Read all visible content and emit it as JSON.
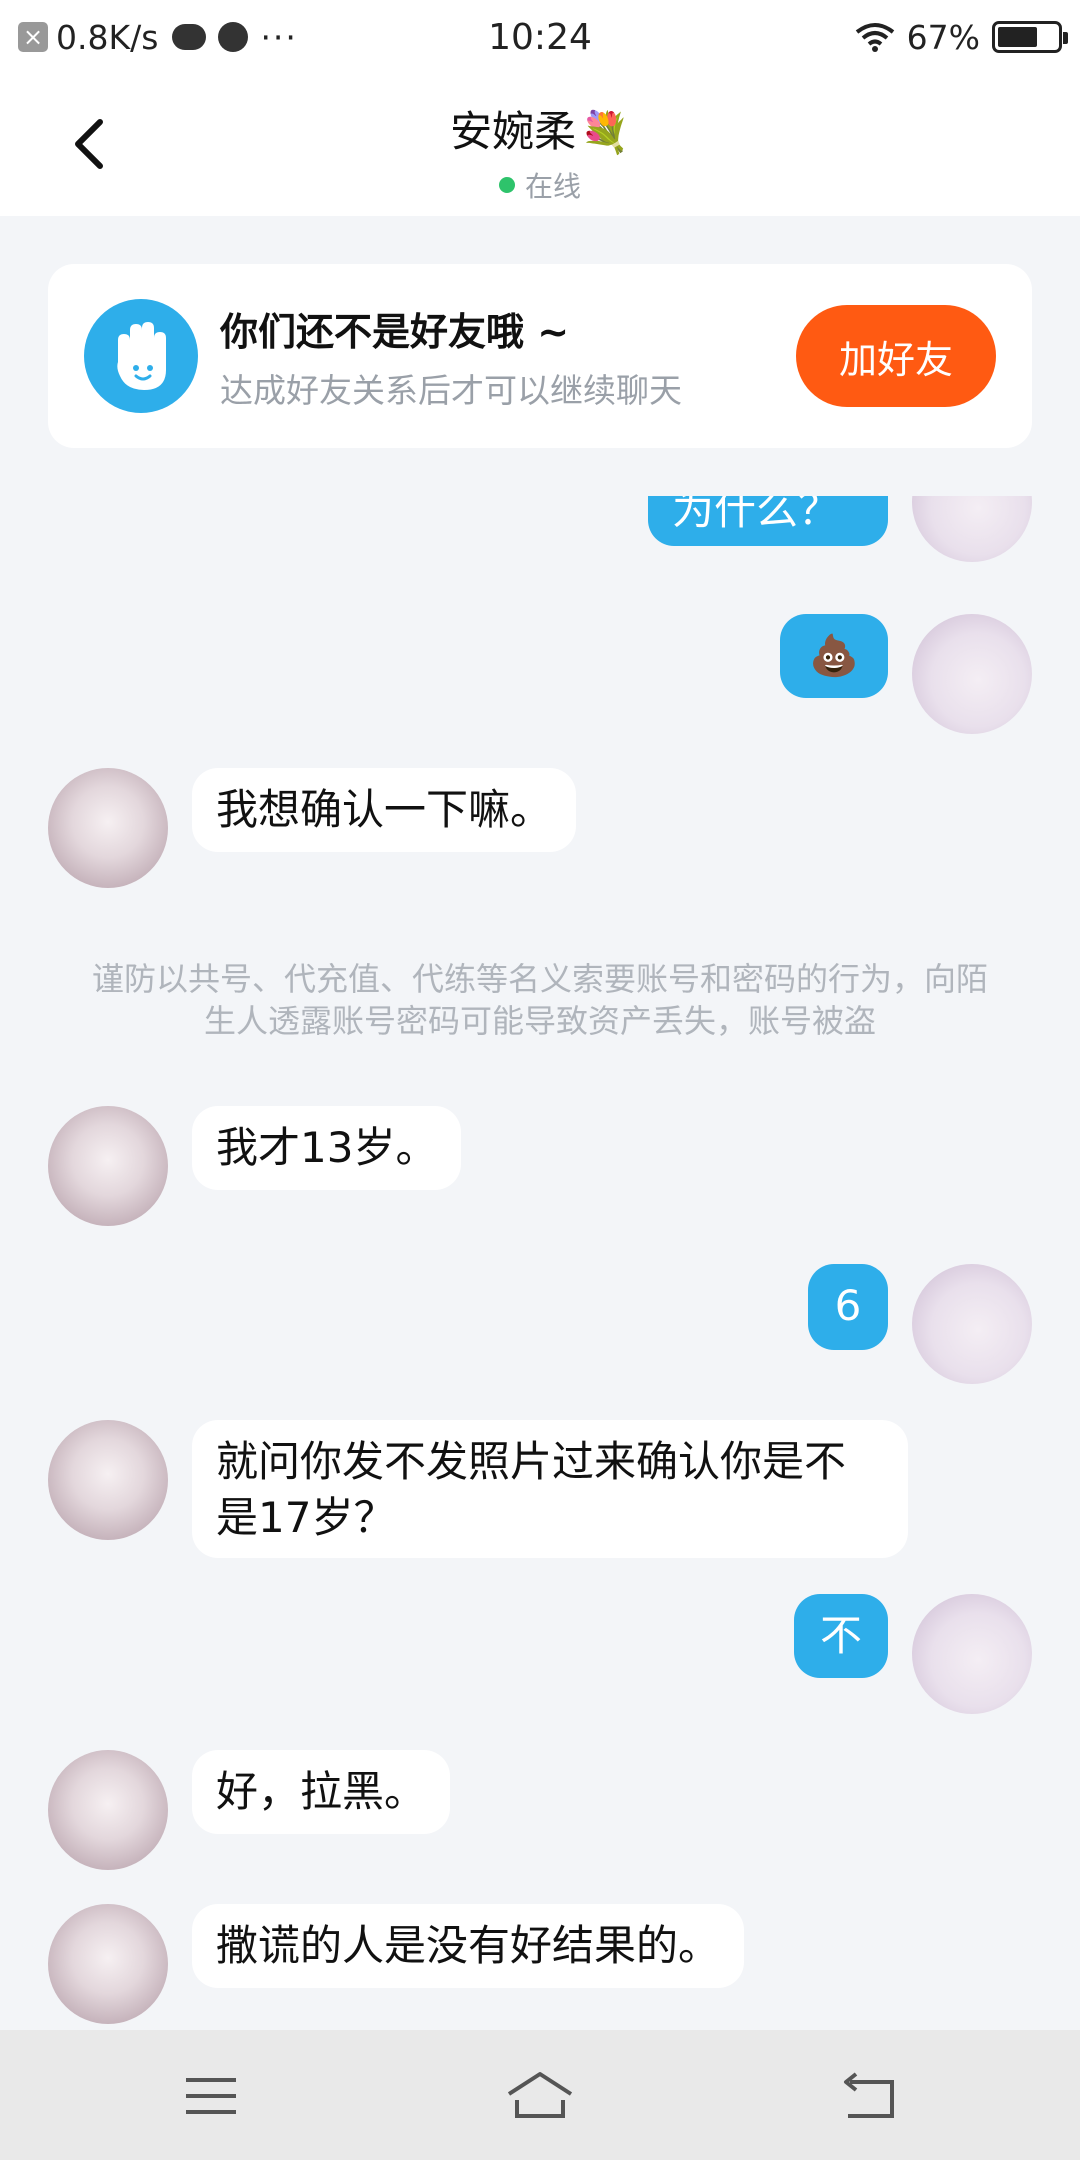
{
  "status_bar": {
    "speed": "0.8K/s",
    "dots": "···",
    "time": "10:24",
    "battery": "67%",
    "battery_level": 0.67
  },
  "header": {
    "title": "安婉柔",
    "title_emoji": "💐",
    "status": "在线"
  },
  "friend_card": {
    "title": "你们还不是好友哦 ~",
    "subtitle": "达成好友关系后才可以继续聊天",
    "button": "加好友"
  },
  "messages": [
    {
      "side": "right",
      "text": "为什么？"
    },
    {
      "side": "right",
      "text": "💩"
    },
    {
      "side": "left",
      "text": "我想确认一下嘛。"
    },
    {
      "side": "left",
      "text": "我才13岁。"
    },
    {
      "side": "right",
      "text": "6"
    },
    {
      "side": "left",
      "text": "就问你发不发照片过来确认你是不是17岁？"
    },
    {
      "side": "right",
      "text": "不"
    },
    {
      "side": "left",
      "text": "好，拉黑。"
    },
    {
      "side": "left",
      "text": "撒谎的人是没有好结果的。"
    }
  ],
  "notice": "谨防以共号、代充值、代练等名义索要账号和密码的行为，向陌生人透露账号密码可能导致资产丢失，账号被盗",
  "colors": {
    "accent": "#2eaeea",
    "add_button": "#ff5a12",
    "online": "#2ec36b"
  }
}
